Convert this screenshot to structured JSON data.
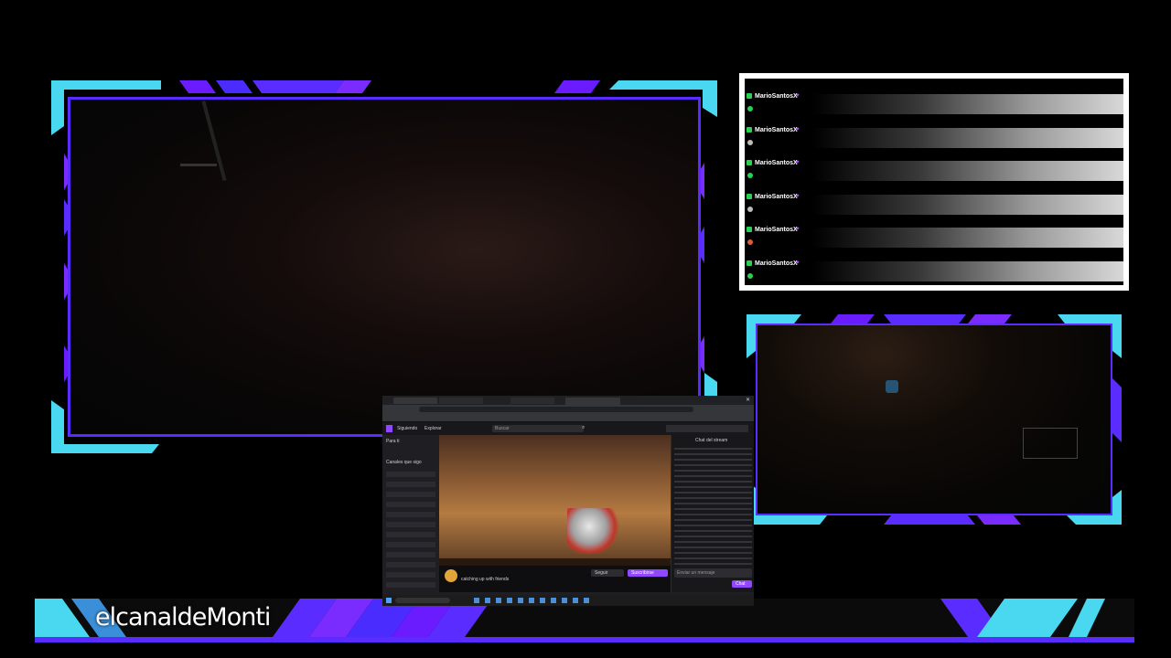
{
  "overlay": {
    "channel_name": "elcanaldeMonti",
    "accent_colors": {
      "purple": "#5a2cff",
      "cyan": "#49d8f0",
      "violet": "#7a2cff"
    }
  },
  "chat": {
    "messages": [
      {
        "user": "MarioSantosX",
        "badge": "subscriber-icon"
      },
      {
        "user": "MarioSantosX",
        "badge": "subscriber-icon"
      },
      {
        "user": "MarioSantosX",
        "badge": "subscriber-icon"
      },
      {
        "user": "MarioSantosX",
        "badge": "subscriber-icon"
      },
      {
        "user": "MarioSantosX",
        "badge": "subscriber-icon"
      },
      {
        "user": "MarioSantosX",
        "badge": "subscriber-icon"
      }
    ]
  },
  "screenshare": {
    "nav": {
      "following": "Siguiendo",
      "browse": "Explorar",
      "search_placeholder": "Buscar"
    },
    "sidebar": {
      "title": "Para ti",
      "section": "Canales que sigo"
    },
    "stream": {
      "title": "catching up with friends",
      "follow": "Seguir",
      "subscribe": "Suscribirse"
    },
    "chat": {
      "title": "Chat del stream",
      "input_placeholder": "Enviar un mensaje",
      "send": "Chat"
    }
  }
}
